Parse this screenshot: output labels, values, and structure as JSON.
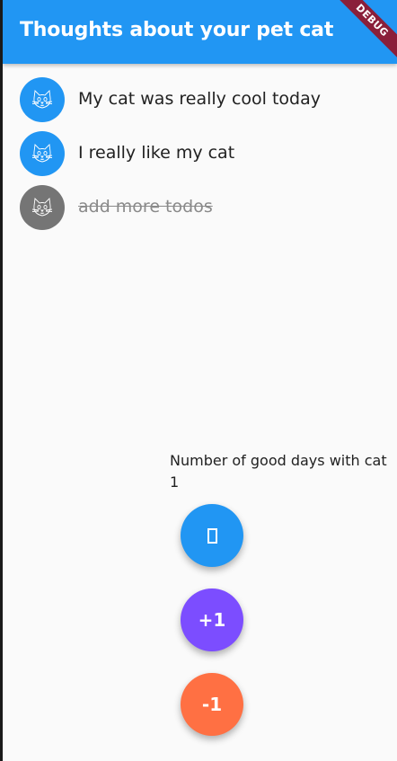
{
  "appbar": {
    "title": "Thoughts about your pet cat",
    "color": "#2196f3"
  },
  "debug_banner": {
    "label": "DEBUG"
  },
  "todos": [
    {
      "text": "My cat was really cool today",
      "done": false,
      "icon": "cat-icon"
    },
    {
      "text": "I really like my cat",
      "done": false,
      "icon": "cat-icon"
    },
    {
      "text": "add more todos",
      "done": true,
      "icon": "cat-icon"
    }
  ],
  "counter": {
    "label": "Number of good days with cat",
    "value": "1"
  },
  "buttons": {
    "unknown_icon": "missing-glyph-icon",
    "plus_label": "+1",
    "minus_label": "-1"
  },
  "colors": {
    "primary": "#2196f3",
    "done_avatar": "#757575",
    "plus_button": "#7c4dff",
    "minus_button": "#ff7043"
  }
}
